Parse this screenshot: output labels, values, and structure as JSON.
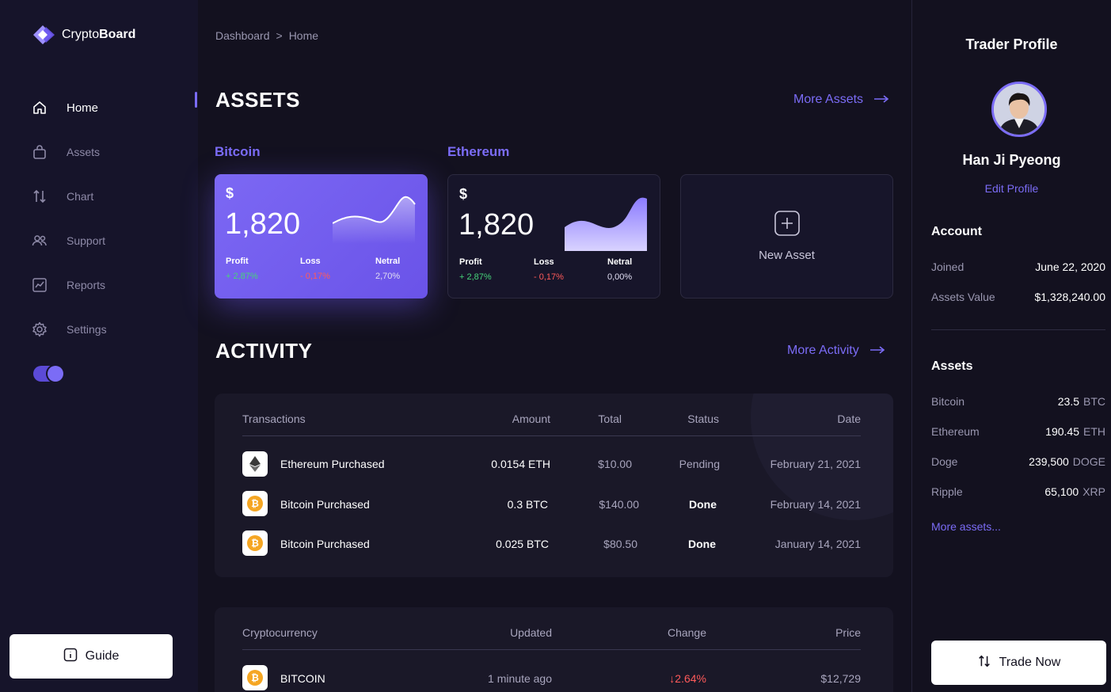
{
  "app": {
    "name_plain": "Crypto",
    "name_bold": "Board"
  },
  "breadcrumb": [
    "Dashboard",
    ">",
    "Home"
  ],
  "sidebar": {
    "items": [
      {
        "label": "Home",
        "icon": "home-icon"
      },
      {
        "label": "Assets",
        "icon": "bag-icon"
      },
      {
        "label": "Chart",
        "icon": "swap-arrows-icon"
      },
      {
        "label": "Support",
        "icon": "users-icon"
      },
      {
        "label": "Reports",
        "icon": "report-chart-icon"
      },
      {
        "label": "Settings",
        "icon": "gear-icon"
      }
    ],
    "guide_label": "Guide"
  },
  "assets": {
    "title": "ASSETS",
    "more_label": "More Assets",
    "cards": [
      {
        "name": "Bitcoin",
        "currency": "$",
        "value": "1,820",
        "stats": [
          {
            "label": "Profit",
            "value": "+ 2,87%"
          },
          {
            "label": "Loss",
            "value": "- 0,17%"
          },
          {
            "label": "Netral",
            "value": "2,70%"
          }
        ]
      },
      {
        "name": "Ethereum",
        "currency": "$",
        "value": "1,820",
        "stats": [
          {
            "label": "Profit",
            "value": "+ 2,87%"
          },
          {
            "label": "Loss",
            "value": "- 0,17%"
          },
          {
            "label": "Netral",
            "value": "0,00%"
          }
        ]
      }
    ],
    "new_asset_label": "New Asset"
  },
  "activity": {
    "title": "ACTIVITY",
    "more_label": "More Activity",
    "headers": {
      "transactions": "Transactions",
      "amount": "Amount",
      "total": "Total",
      "status": "Status",
      "date": "Date"
    },
    "rows": [
      {
        "coin": "ethereum",
        "name": "Ethereum Purchased",
        "amount": "0.0154 ETH",
        "total": "$10.00",
        "status": "Pending",
        "date": "February 21, 2021"
      },
      {
        "coin": "bitcoin",
        "name": "Bitcoin Purchased",
        "amount": "0.3 BTC",
        "total": "$140.00",
        "status": "Done",
        "date": "February 14, 2021"
      },
      {
        "coin": "bitcoin",
        "name": "Bitcoin Purchased",
        "amount": "0.025 BTC",
        "total": "$80.50",
        "status": "Done",
        "date": "January 14, 2021"
      }
    ]
  },
  "crypto_table": {
    "headers": {
      "cryptocurrency": "Cryptocurrency",
      "updated": "Updated",
      "change": "Change",
      "price": "Price"
    },
    "rows": [
      {
        "name": "BITCOIN",
        "updated": "1 minute ago",
        "change": "2.64%",
        "price": "$12,729"
      }
    ]
  },
  "profile": {
    "title": "Trader Profile",
    "name": "Han Ji Pyeong",
    "edit_label": "Edit Profile",
    "account_title": "Account",
    "joined_label": "Joined",
    "joined_value": "June 22, 2020",
    "assets_value_label": "Assets Value",
    "assets_value": "$1,328,240.00",
    "assets_title": "Assets",
    "holdings": [
      {
        "name": "Bitcoin",
        "amount": "23.5",
        "unit": "BTC"
      },
      {
        "name": "Ethereum",
        "amount": "190.45",
        "unit": "ETH"
      },
      {
        "name": "Doge",
        "amount": "239,500",
        "unit": "DOGE"
      },
      {
        "name": "Ripple",
        "amount": "65,100",
        "unit": "XRP"
      }
    ],
    "more_assets_label": "More assets...",
    "trade_label": "Trade Now"
  },
  "colors": {
    "accent": "#7b6cf6",
    "background": "#13111f",
    "positive": "#46d37a",
    "negative": "#ff5a5a"
  }
}
